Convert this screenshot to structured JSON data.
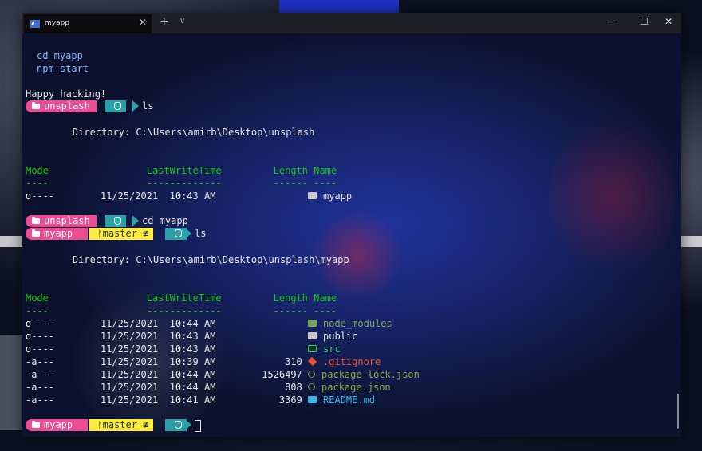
{
  "titlebar": {
    "tab_title": "myapp",
    "tab_close": "✕",
    "new_tab": "+",
    "dropdown": "∨",
    "minimize": "—",
    "maximize": "☐",
    "close": "✕"
  },
  "terminal": {
    "hint_lines": [
      "cd myapp",
      "npm start"
    ],
    "greeting": "Happy hacking!",
    "prompts": {
      "p1": {
        "folder": "unsplash",
        "command": "ls"
      },
      "p2": {
        "folder": "unsplash",
        "command": "cd myapp"
      },
      "p3": {
        "folder": "myapp",
        "branch": "master ≢",
        "command": "ls"
      },
      "p4": {
        "folder": "myapp",
        "branch": "master ≢",
        "command": ""
      }
    },
    "listing1": {
      "directory": "    Directory: C:\\Users\\amirb\\Desktop\\unsplash",
      "headers": "Mode                 LastWriteTime         Length Name",
      "underline": "----                 -------------         ------ ----",
      "rows": [
        {
          "mode": "d----",
          "date": "11/25/2021",
          "time": "10:43 AM",
          "length": "",
          "name": "myapp",
          "kind": "folder"
        }
      ]
    },
    "listing2": {
      "directory": "    Directory: C:\\Users\\amirb\\Desktop\\unsplash\\myapp",
      "headers": "Mode                 LastWriteTime         Length Name",
      "underline": "----                 -------------         ------ ----",
      "rows": [
        {
          "mode": "d----",
          "date": "11/25/2021",
          "time": "10:44 AM",
          "length": "",
          "name": "node_modules",
          "kind": "node"
        },
        {
          "mode": "d----",
          "date": "11/25/2021",
          "time": "10:43 AM",
          "length": "",
          "name": "public",
          "kind": "folder"
        },
        {
          "mode": "d----",
          "date": "11/25/2021",
          "time": "10:43 AM",
          "length": "",
          "name": "src",
          "kind": "src"
        },
        {
          "mode": "-a---",
          "date": "11/25/2021",
          "time": "10:39 AM",
          "length": "310",
          "name": ".gitignore",
          "kind": "git"
        },
        {
          "mode": "-a---",
          "date": "11/25/2021",
          "time": "10:44 AM",
          "length": "1526497",
          "name": "package-lock.json",
          "kind": "json"
        },
        {
          "mode": "-a---",
          "date": "11/25/2021",
          "time": "10:44 AM",
          "length": "808",
          "name": "package.json",
          "kind": "json"
        },
        {
          "mode": "-a---",
          "date": "11/25/2021",
          "time": "10:41 AM",
          "length": "3369",
          "name": "README.md",
          "kind": "md"
        }
      ]
    }
  },
  "colors": {
    "prompt_pink": "#ec4c92",
    "prompt_teal": "#2aa1a8",
    "prompt_yellow": "#ffeb3b",
    "header_green": "#16c60c"
  }
}
